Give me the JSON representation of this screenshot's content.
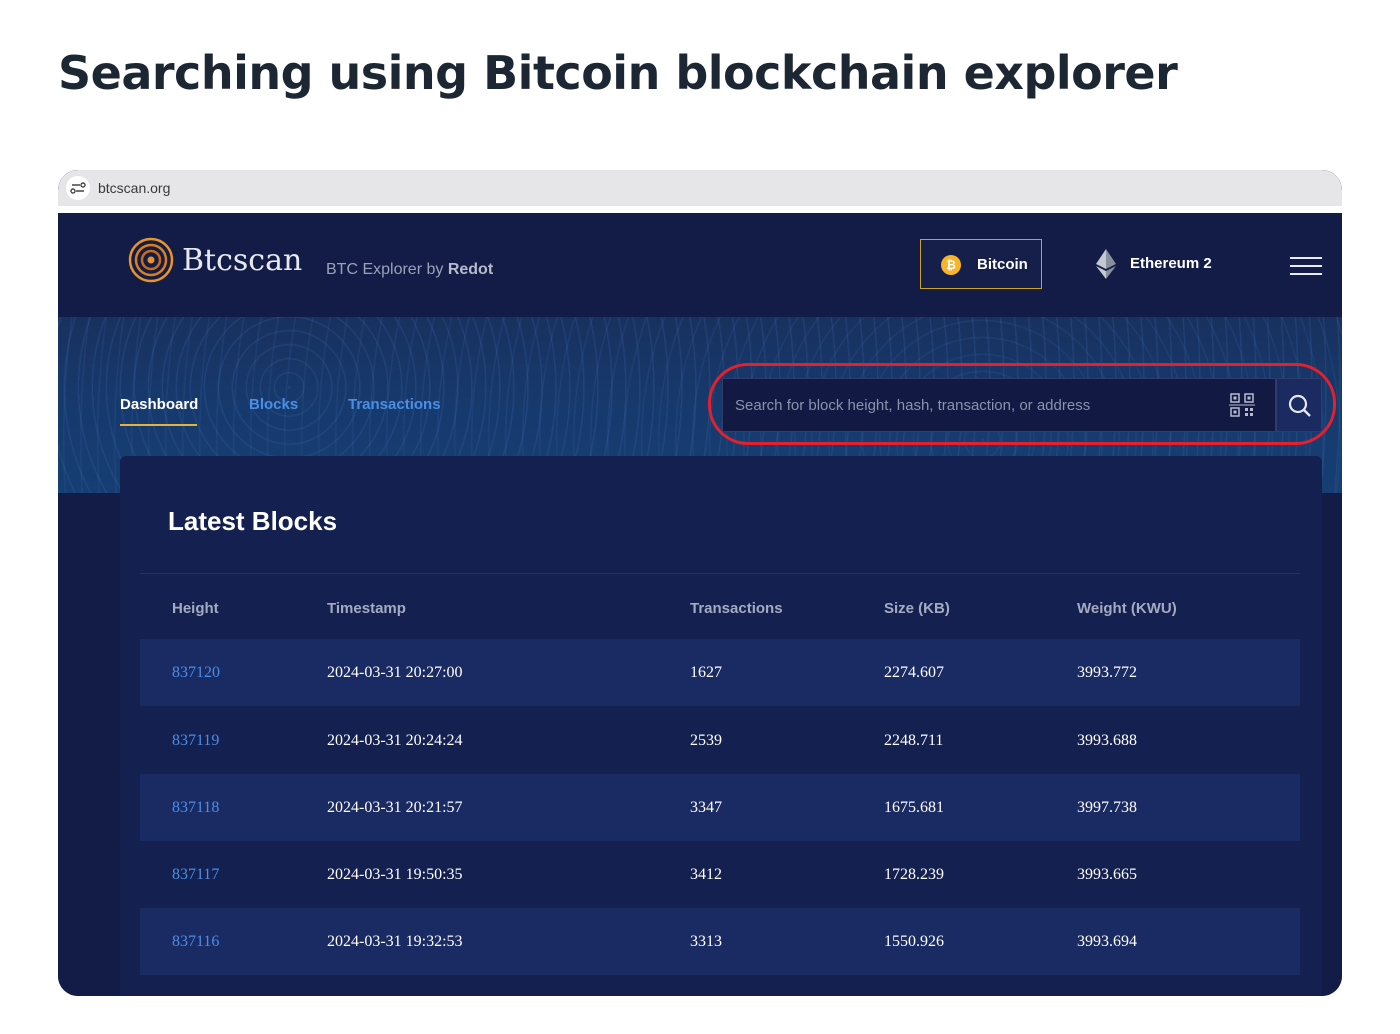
{
  "page": {
    "heading": "Searching using Bitcoin blockchain explorer"
  },
  "browser": {
    "url": "btcscan.org"
  },
  "header": {
    "logo_text": "Btcscan",
    "tagline_prefix": "BTC Explorer by",
    "tagline_brand": "Redot",
    "coins": [
      {
        "label": "Bitcoin",
        "icon": "bitcoin-icon",
        "selected": true
      },
      {
        "label": "Ethereum 2",
        "icon": "ethereum-icon",
        "selected": false
      }
    ],
    "menu_icon": "hamburger-menu-icon"
  },
  "nav": {
    "tabs": [
      {
        "label": "Dashboard",
        "active": true
      },
      {
        "label": "Blocks",
        "active": false
      },
      {
        "label": "Transactions",
        "active": false
      }
    ]
  },
  "search": {
    "placeholder": "Search for block height, hash, transaction, or address",
    "qr_icon": "qr-code-icon",
    "button_icon": "search-icon"
  },
  "latest_blocks": {
    "title": "Latest Blocks",
    "columns": [
      "Height",
      "Timestamp",
      "Transactions",
      "Size (KB)",
      "Weight (KWU)"
    ],
    "rows": [
      [
        "837120",
        "2024-03-31 20:27:00",
        "1627",
        "2274.607",
        "3993.772"
      ],
      [
        "837119",
        "2024-03-31 20:24:24",
        "2539",
        "2248.711",
        "3993.688"
      ],
      [
        "837118",
        "2024-03-31 20:21:57",
        "3347",
        "1675.681",
        "3997.738"
      ],
      [
        "837117",
        "2024-03-31 19:50:35",
        "3412",
        "1728.239",
        "3993.665"
      ],
      [
        "837116",
        "2024-03-31 19:32:53",
        "3313",
        "1550.926",
        "3993.694"
      ]
    ]
  },
  "colors": {
    "background": "#131c46",
    "accent_gold": "#e3b43a",
    "link_blue": "#4a8ee6",
    "highlight_red": "#e3202c"
  }
}
